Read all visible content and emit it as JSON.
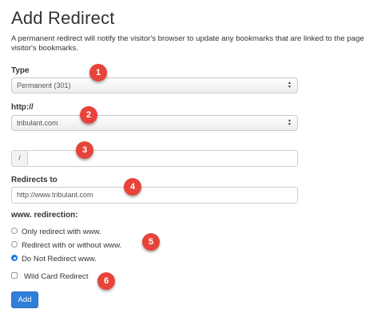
{
  "page": {
    "title": "Add Redirect",
    "description": "A permanent redirect will notify the visitor's browser to update any bookmarks that are linked to the page visitor's bookmarks."
  },
  "form": {
    "type": {
      "label": "Type",
      "value": "Permanent (301)"
    },
    "http": {
      "label": "http://",
      "value": "tribulant.com"
    },
    "path": {
      "prefix": "/",
      "value": ""
    },
    "redirects_to": {
      "label": "Redirects to",
      "value": "http://www.tribulant.com"
    },
    "www": {
      "label": "www. redirection:",
      "options": [
        {
          "label": "Only redirect with www.",
          "checked": false
        },
        {
          "label": "Redirect with or without www.",
          "checked": false
        },
        {
          "label": "Do Not Redirect www.",
          "checked": true
        }
      ]
    },
    "wildcard": {
      "label": "Wild Card Redirect",
      "checked": false
    },
    "submit_label": "Add"
  },
  "badges": [
    "1",
    "2",
    "3",
    "4",
    "5",
    "6"
  ],
  "colors": {
    "badge": "#e6443a",
    "primary_button": "#2f7fd8",
    "radio_checked": "#1e7be8"
  }
}
